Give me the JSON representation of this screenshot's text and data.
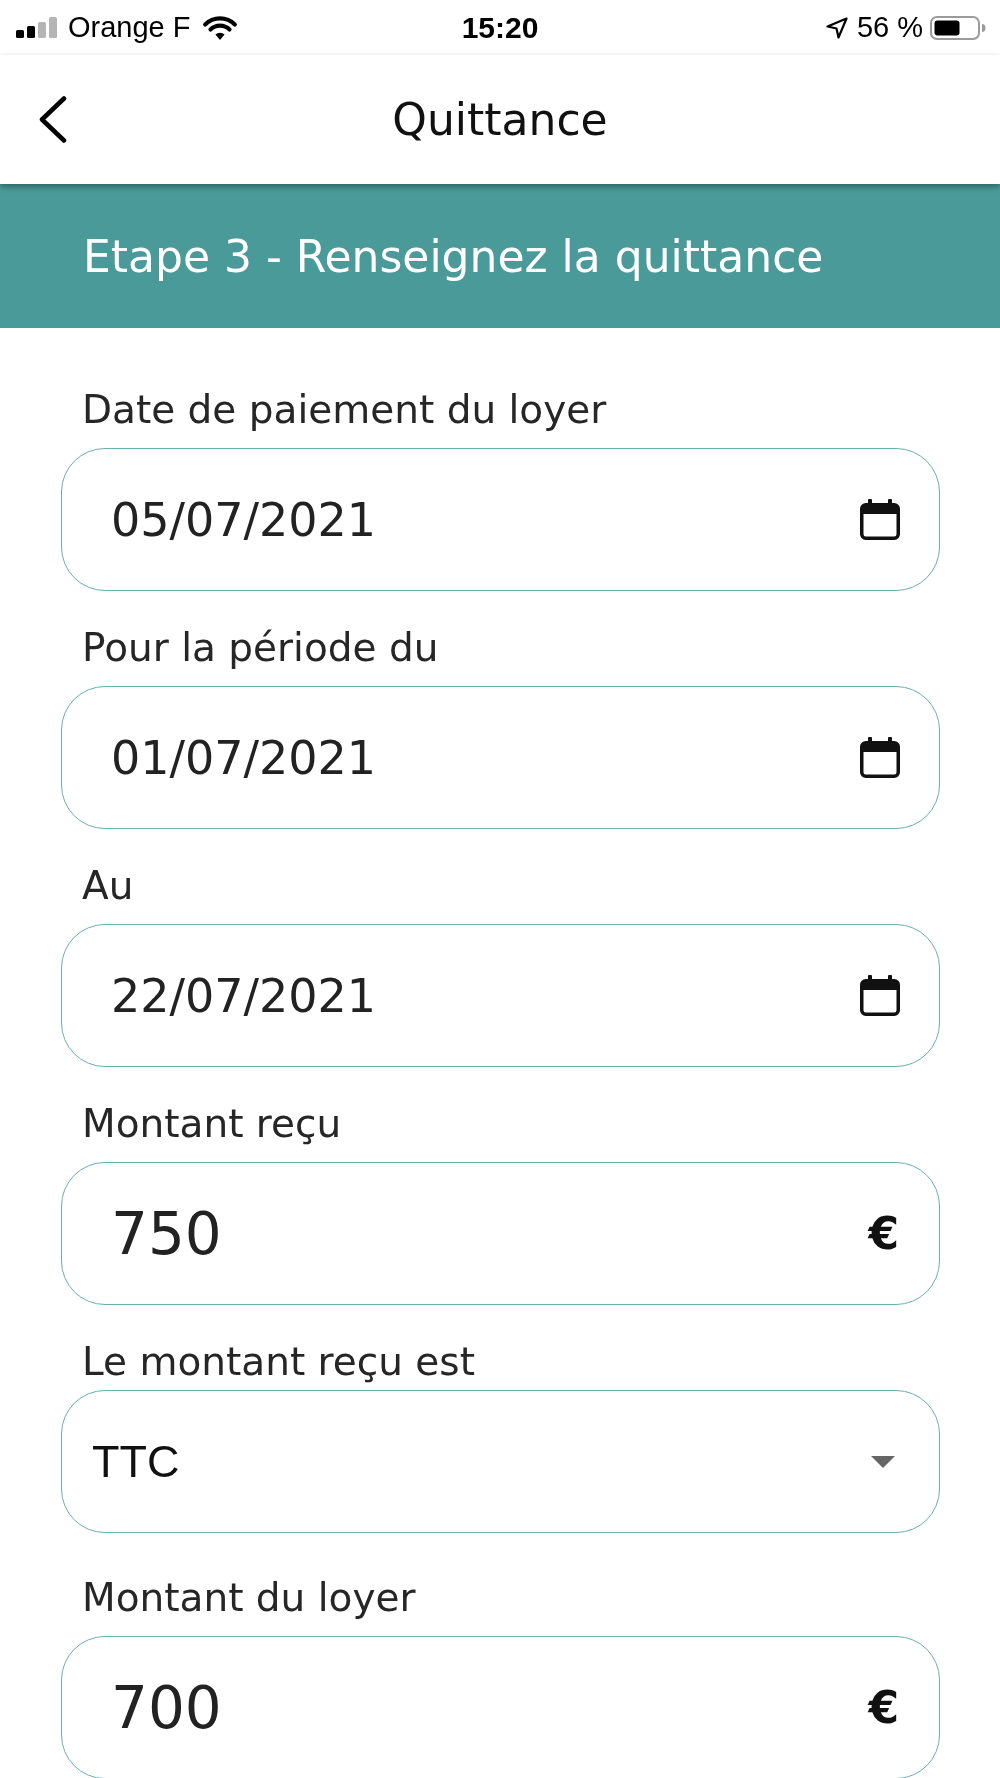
{
  "status_bar": {
    "carrier": "Orange F",
    "time": "15:20",
    "battery": "56 %"
  },
  "nav_bar": {
    "title": "Quittance"
  },
  "step_banner": {
    "title": "Etape 3 - Renseignez la quittance"
  },
  "fields": [
    {
      "kind": "date",
      "label": "Date de paiement du loyer",
      "value": "05/07/2021"
    },
    {
      "kind": "date",
      "label": "Pour la période du",
      "value": "01/07/2021"
    },
    {
      "kind": "date",
      "label": "Au",
      "value": "22/07/2021"
    },
    {
      "kind": "amount",
      "label": "Montant reçu",
      "value": "750",
      "unit": "€"
    },
    {
      "kind": "select",
      "label": "Le montant reçu est",
      "value": "TTC"
    },
    {
      "kind": "amount",
      "label": "Montant du loyer",
      "value": "700",
      "unit": "€"
    }
  ]
}
